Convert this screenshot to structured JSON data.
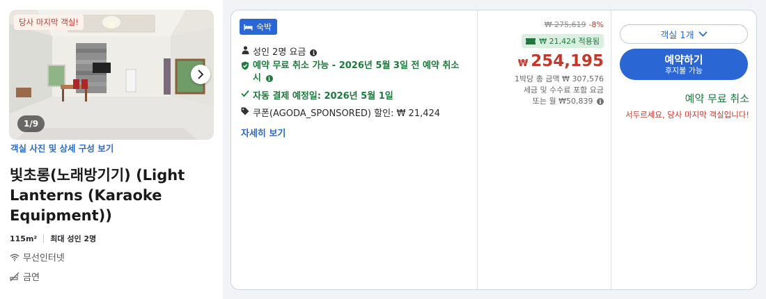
{
  "room": {
    "last_room_tag": "당사 마지막 객실!",
    "photo_counter": "1/9",
    "photos_link": "객실 사진 및 상세 구성 보기",
    "name": "빛초롱(노래방기기) (Light Lanterns (Karaoke Equipment))",
    "size": "115m²",
    "max_occupancy": "최대 성인 2명",
    "amenities": [
      {
        "icon": "wifi-icon",
        "label": "무선인터넷"
      },
      {
        "icon": "no-smoking-icon",
        "label": "금연"
      }
    ]
  },
  "offer": {
    "badge": "숙박",
    "occupancy_rate": "성인 2명 요금",
    "free_cancel_policy": "예약 무료 취소 가능 - 2026년 5월 3일 전 예약 취소 시",
    "auto_payment": "자동 결제 예정일: 2026년 5월 1일",
    "coupon": "쿠폰(AGODA_SPONSORED) 할인: ₩ 21,424",
    "details_link": "자세히 보기"
  },
  "price": {
    "original": "₩ 275,619",
    "discount_pct": "-8%",
    "coupon_applied": "₩ 21,424 적용됨",
    "currency": "₩",
    "final": "254,195",
    "per_night_total": "1박당 총 금액 ₩ 307,576",
    "tax_note": "세금 및 수수료 포함 요금",
    "monthly": "또는 월 ₩50,839"
  },
  "actions": {
    "rooms_select": "객실 1개",
    "book_label": "예약하기",
    "book_sub": "후지불 가능",
    "free_cancel": "예약 무료 취소",
    "hurry_message": "서두르세요, 당사 마지막 객실입니다!"
  },
  "colors": {
    "brand_blue": "#2b67d4",
    "link_blue": "#2a6bc9",
    "price_red": "#c4372b",
    "success_green": "#1d7a3c"
  }
}
